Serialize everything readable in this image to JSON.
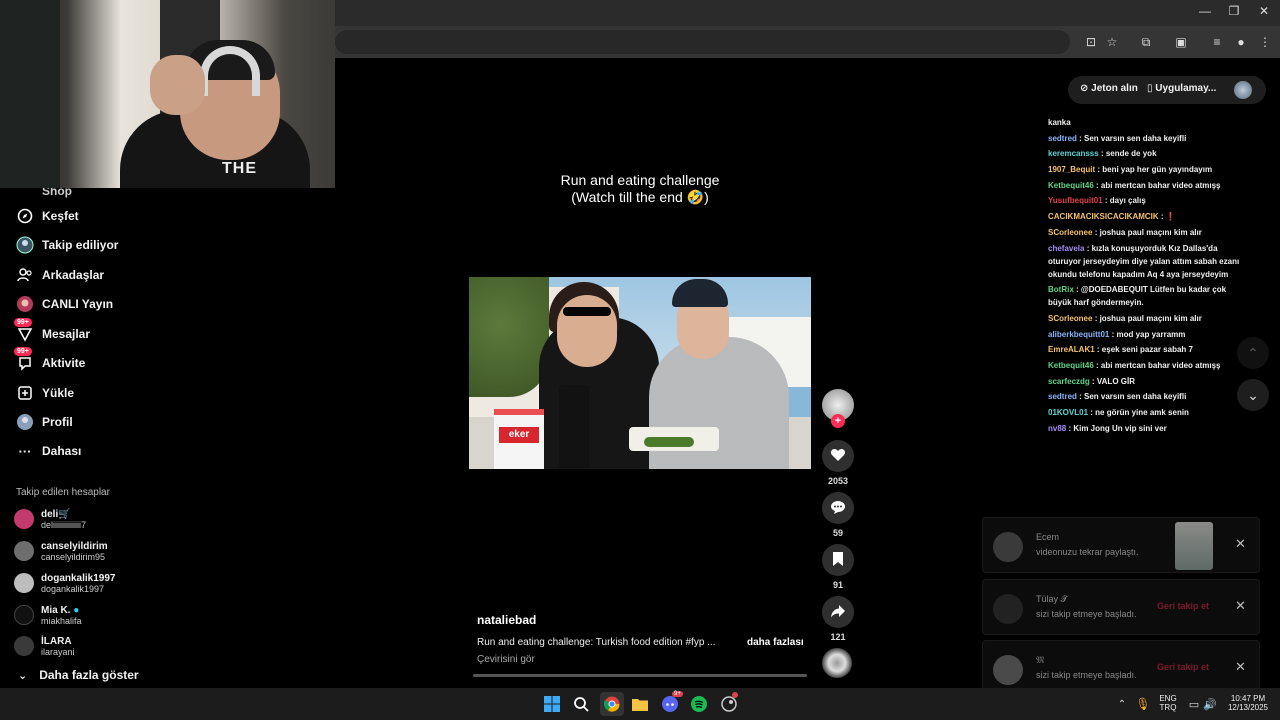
{
  "browser": {
    "window_controls": {
      "minimize": "—",
      "restore": "❐",
      "close": "✕"
    },
    "toolbar_icons": [
      "install-icon",
      "star-icon",
      "extensions-icon",
      "split-view-icon",
      "media-icon",
      "profile-icon",
      "menu-icon"
    ]
  },
  "webcam": {
    "shirt_text": "THE"
  },
  "sidebar": {
    "partial_item": "Shop",
    "items": [
      {
        "label": "Keşfet",
        "icon": "compass-icon"
      },
      {
        "label": "Takip ediliyor",
        "icon": "following-icon"
      },
      {
        "label": "Arkadaşlar",
        "icon": "friends-icon"
      },
      {
        "label": "CANLI Yayın",
        "icon": "live-icon"
      },
      {
        "label": "Mesajlar",
        "icon": "messages-icon",
        "badge": "99+"
      },
      {
        "label": "Aktivite",
        "icon": "activity-icon",
        "badge": "99+"
      },
      {
        "label": "Yükle",
        "icon": "upload-icon"
      },
      {
        "label": "Profil",
        "icon": "profile-icon"
      },
      {
        "label": "Dahası",
        "icon": "more-icon"
      }
    ],
    "following_title": "Takip edilen hesaplar",
    "accounts": [
      {
        "name": "deli🛒",
        "handle": "deliiiiiiiiiiiiii7",
        "color": "#c23a6e"
      },
      {
        "name": "canselyildirim",
        "handle": "canselyildirim95",
        "color": "#6e6e6e"
      },
      {
        "name": "dogankalik1997",
        "handle": "dogankalik1997",
        "color": "#bdbdbd"
      },
      {
        "name": "Mia K.",
        "handle": "miakhalifa",
        "color": "#111111",
        "verified": true
      },
      {
        "name": "İLARA",
        "handle": "ilarayani",
        "color": "#3a3a3a"
      }
    ],
    "show_more": "Daha fazla göster"
  },
  "video": {
    "caption_line1": "Run and eating challenge",
    "caption_line2": "(Watch till the end 🤣)",
    "cup_label": "eker",
    "author": "nataliebad",
    "description": "Run and eating challenge: Turkish food edition #fyp ...",
    "more": "daha fazlası",
    "translate": "Çevirisini gör",
    "likes": "2053",
    "comments": "59",
    "saves": "91",
    "shares": "121"
  },
  "topbar": {
    "coins": "Jeton alın",
    "app": "Uygulamay..."
  },
  "chat": [
    {
      "user": "",
      "text": "kanka",
      "color": "#f1f1f1"
    },
    {
      "user": "sedtred",
      "text": " : Sen varsın sen daha keyifli",
      "color": "#8ab4f8"
    },
    {
      "user": "keremcansss",
      "text": " : sende de yok",
      "color": "#5fd4d4"
    },
    {
      "user": "1907_Bequit",
      "text": " : beni yap her gün yayındayım",
      "color": "#f5c16c"
    },
    {
      "user": "Ketbequit46",
      "text": " : abi mertcan bahar video atmışş",
      "color": "#5fd48a"
    },
    {
      "user": "Yusufbequit01",
      "text": " : dayı çalış",
      "color": "#e0414f"
    },
    {
      "user": "CACIKMACIKSICACIKAMCIK",
      "text": " : ❗",
      "color": "#f5c16c"
    },
    {
      "user": "SCorleonee",
      "text": " : joshua paul maçını kim alır",
      "color": "#f5c16c"
    },
    {
      "user": "chefavela",
      "text": " : kızla konuşuyorduk Kız Dallas'da oturuyor jerseydeyim diye yalan attım sabah ezanı okundu telefonu kapadım Aq 4 aya jerseydeyim",
      "color": "#a58cf5"
    },
    {
      "user": "BotRix",
      "text": " : @DOEDABEQUIT Lütfen bu kadar çok büyük harf göndermeyin.",
      "color": "#5fd48a"
    },
    {
      "user": "SCorleonee",
      "text": " : joshua paul maçını kim alır",
      "color": "#f5c16c"
    },
    {
      "user": "aliberkbequitt01",
      "text": " : mod yap yarramm",
      "color": "#8ab4f8"
    },
    {
      "user": "EmreALAK1",
      "text": " : eşek seni pazar sabah 7",
      "color": "#f5c16c"
    },
    {
      "user": "Ketbequit46",
      "text": " : abi mertcan bahar video atmışş",
      "color": "#5fd48a"
    },
    {
      "user": "scarfeczdg",
      "text": " : VALO GİR",
      "color": "#5fd48a"
    },
    {
      "user": "sedtred",
      "text": " : Sen varsın sen daha keyifli",
      "color": "#8ab4f8"
    },
    {
      "user": "01KOVL01",
      "text": " : ne görün yine amk senin",
      "color": "#5fd4d4"
    },
    {
      "user": "nv88",
      "text": " : Kim Jong Un vip sini ver",
      "color": "#a58cf5"
    }
  ],
  "notifications": [
    {
      "name": "Ecem",
      "text": "videonuzu tekrar paylaştı.",
      "action": "",
      "color": "#3a3a3a"
    },
    {
      "name": "Tülay 𝓣",
      "text": "sizi takip etmeye başladı.",
      "action": "Geri takip et",
      "color": "#222222"
    },
    {
      "name": "𝔐",
      "text": "sizi takip etmeye başladı.",
      "action": "Geri takip et",
      "color": "#4a4a4a"
    }
  ],
  "taskbar": {
    "lang1": "ENG",
    "lang2": "TRQ",
    "time": "10:47 PM",
    "date": "12/13/2025",
    "discord_badge": "9+"
  }
}
